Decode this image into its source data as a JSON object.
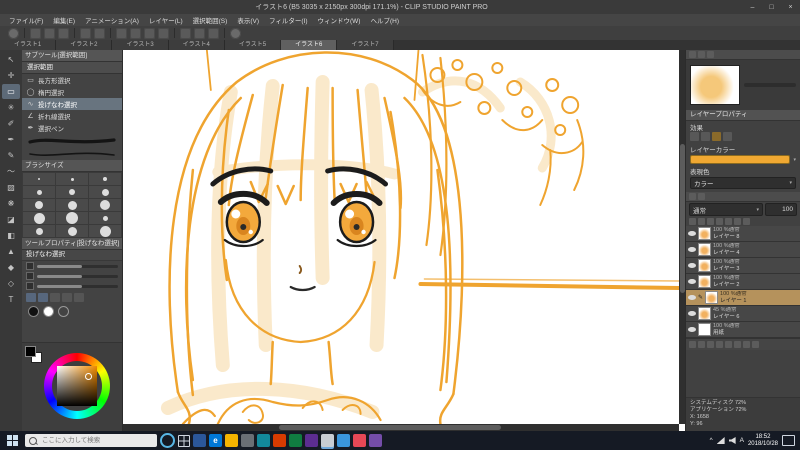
{
  "window": {
    "title": "イラスト6 (B5 3035 x 2150px 300dpi 171.1%) - CLIP STUDIO PAINT PRO",
    "controls": {
      "minimize": "–",
      "maximize": "□",
      "close": "×"
    }
  },
  "menu": {
    "items": [
      "ファイル(F)",
      "編集(E)",
      "アニメーション(A)",
      "レイヤー(L)",
      "選択範囲(S)",
      "表示(V)",
      "フィルター(I)",
      "ウィンドウ(W)",
      "ヘルプ(H)"
    ]
  },
  "doc_tabs": {
    "items": [
      "イラスト1",
      "イラスト2",
      "イラスト3",
      "イラスト4",
      "イラスト5",
      "イラスト6",
      "イラスト7"
    ],
    "active": "イラスト6"
  },
  "tool_strip": {
    "selected_index": 2,
    "tools": [
      {
        "name": "operation",
        "glyph": "↖"
      },
      {
        "name": "move",
        "glyph": "✛"
      },
      {
        "name": "selection",
        "glyph": "▭"
      },
      {
        "name": "auto-select",
        "glyph": "✳"
      },
      {
        "name": "eyedropper",
        "glyph": "✐"
      },
      {
        "name": "pen",
        "glyph": "✒"
      },
      {
        "name": "pencil",
        "glyph": "✎"
      },
      {
        "name": "brush",
        "glyph": "～"
      },
      {
        "name": "airbrush",
        "glyph": "▨"
      },
      {
        "name": "decoration",
        "glyph": "❋"
      },
      {
        "name": "eraser",
        "glyph": "◪"
      },
      {
        "name": "blend",
        "glyph": "◧"
      },
      {
        "name": "fill",
        "glyph": "▲"
      },
      {
        "name": "gradient",
        "glyph": "◆"
      },
      {
        "name": "figure",
        "glyph": "◇"
      },
      {
        "name": "text",
        "glyph": "T"
      }
    ]
  },
  "subtool": {
    "header": "サブツール[選択範囲]",
    "group_label": "選択範囲",
    "selected": "投げなわ選択",
    "tools": [
      {
        "label": "長方形選択",
        "glyph": "▭"
      },
      {
        "label": "楕円選択",
        "glyph": "◯"
      },
      {
        "label": "投げなわ選択",
        "glyph": "∿"
      },
      {
        "label": "折れ線選択",
        "glyph": "∠"
      },
      {
        "label": "選択ペン",
        "glyph": "✒"
      }
    ]
  },
  "brush_size_panel": {
    "header": "ブラシサイズ"
  },
  "tool_property": {
    "header": "ツールプロパティ[投げなわ選択]",
    "tool_name": "投げなわ選択"
  },
  "layer_property": {
    "header": "レイヤープロパティ",
    "effect_label": "効果",
    "layer_color_label": "レイヤーカラー",
    "layer_color_value": "#f0a832",
    "expression_label": "表現色",
    "expression_value": "カラー"
  },
  "layer_panel": {
    "blend_mode": "通常",
    "opacity": "100",
    "layers": [
      {
        "meta": "100 %通常",
        "name": "レイヤー 8",
        "selected": false
      },
      {
        "meta": "100 %通常",
        "name": "レイヤー 4",
        "selected": false
      },
      {
        "meta": "100 %通常",
        "name": "レイヤー 3",
        "selected": false
      },
      {
        "meta": "100 %通常",
        "name": "レイヤー 2",
        "selected": false
      },
      {
        "meta": "100 %通常",
        "name": "レイヤー 1",
        "selected": true
      },
      {
        "meta": "45 %通常",
        "name": "レイヤー 6",
        "selected": false
      },
      {
        "meta": "100 %通常",
        "name": "用紙",
        "selected": false
      }
    ]
  },
  "status": {
    "disk_label": "システムディスク 72%",
    "app_label": "アプリケーション 72%",
    "x_label": "X: 1658",
    "y_label": "Y: 96"
  },
  "taskbar": {
    "search_placeholder": "ここに入力して検索",
    "edge_glyph": "e",
    "ime": "A",
    "tray_chevron": "^",
    "time": "18:52",
    "date": "2018/10/28"
  },
  "command_bar": {
    "icons": [
      "hide-palettes",
      "new",
      "open",
      "save",
      "undo",
      "redo",
      "delete",
      "deselect",
      "invert-selection",
      "border-select",
      "zoom-in",
      "zoom-out",
      "grid",
      "settings",
      "help"
    ]
  },
  "colors": {
    "accent_orange": "#f0a832",
    "selected_layer_bg": "#b5925c",
    "canvas_line": "#efa42f",
    "canvas_black": "#1c1c1c"
  }
}
